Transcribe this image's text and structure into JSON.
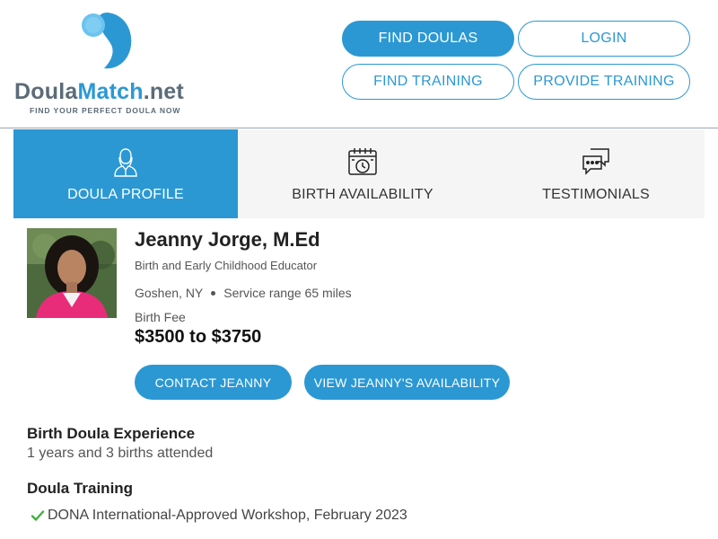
{
  "brand": {
    "name_part1": "Doula",
    "name_part2": "Match",
    "name_part3": ".net",
    "tagline": "FIND YOUR PERFECT DOULA NOW",
    "primary_color": "#2b98d4",
    "secondary_color": "#5b6b78"
  },
  "nav": {
    "find_doulas": "FIND DOULAS",
    "login": "LOGIN",
    "find_training": "FIND TRAINING",
    "provide_training": "PROVIDE TRAINING"
  },
  "tabs": [
    {
      "label": "DOULA PROFILE",
      "icon": "person-icon",
      "active": true
    },
    {
      "label": "BIRTH AVAILABILITY",
      "icon": "calendar-clock-icon",
      "active": false
    },
    {
      "label": "TESTIMONIALS",
      "icon": "chat-bubbles-icon",
      "active": false
    }
  ],
  "profile": {
    "name": "Jeanny Jorge, M.Ed",
    "subtitle": "Birth and Early Childhood Educator",
    "location": "Goshen, NY",
    "service_range": "Service range 65 miles",
    "fee_label": "Birth Fee",
    "fee_value": "$3500 to $3750",
    "contact_button": "CONTACT JEANNY",
    "availability_button": "VIEW JEANNY'S AVAILABILITY"
  },
  "experience": {
    "title": "Birth Doula Experience",
    "text": "1 years and 3 births attended"
  },
  "training": {
    "title": "Doula Training",
    "items": [
      "DONA International-Approved Workshop, February 2023"
    ],
    "check_color": "#3cb33c"
  }
}
